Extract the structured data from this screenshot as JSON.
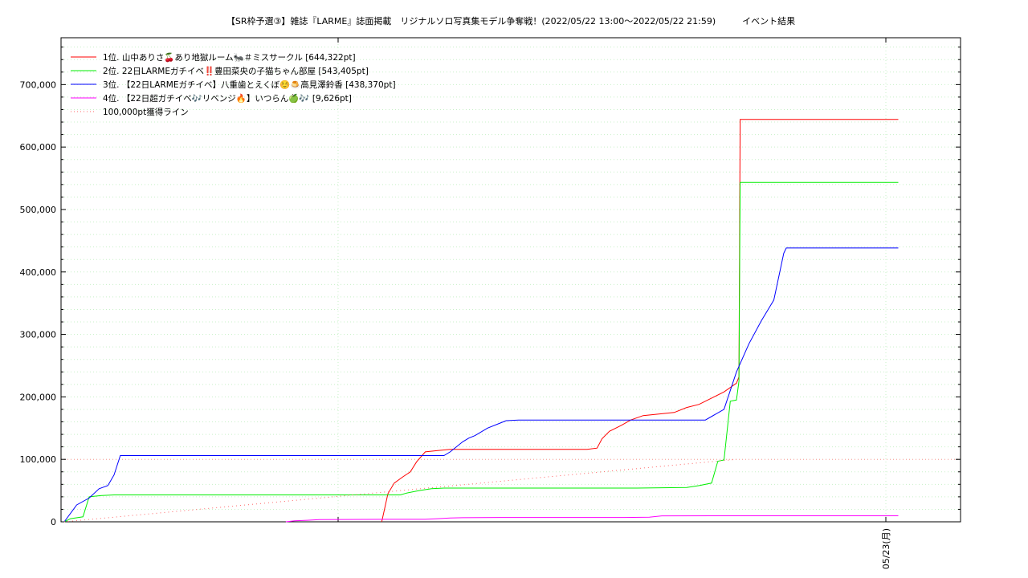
{
  "chart_data": {
    "type": "line",
    "title": "【SR枠予選③】雑誌『LARME』誌面掲載　リジナルソロ写真集モデル争奪戦！(2022/05/22 13:00～2022/05/22 21:59)　　　イベント結果",
    "xlabel": "",
    "ylabel": "",
    "x_unit": "minutes since 2022/05/22 13:00",
    "xlim": [
      0,
      660
    ],
    "ylim": [
      0,
      775000
    ],
    "yticks": [
      0,
      100000,
      200000,
      300000,
      400000,
      500000,
      600000,
      700000
    ],
    "ytick_labels": [
      "0",
      "100,000",
      "200,000",
      "300,000",
      "400,000",
      "500,000",
      "600,000",
      "700,000"
    ],
    "xticks": [
      {
        "x": 660,
        "label": "05/23(月)"
      }
    ],
    "grid": true,
    "legend_position": "top-left",
    "series": [
      {
        "name": "1位. 山中ありさ🍒あり地獄ルーム🐜＃ミスサークル [644,322pt]",
        "color": "#ff0000",
        "style": "solid",
        "points": [
          [
            255,
            0
          ],
          [
            260,
            45000
          ],
          [
            265,
            62000
          ],
          [
            272,
            72000
          ],
          [
            278,
            80000
          ],
          [
            283,
            96000
          ],
          [
            290,
            112000
          ],
          [
            300,
            114000
          ],
          [
            310,
            116000
          ],
          [
            400,
            116000
          ],
          [
            420,
            116000
          ],
          [
            428,
            118000
          ],
          [
            432,
            133000
          ],
          [
            438,
            145000
          ],
          [
            448,
            155000
          ],
          [
            455,
            163000
          ],
          [
            465,
            170000
          ],
          [
            480,
            173000
          ],
          [
            490,
            175000
          ],
          [
            500,
            183000
          ],
          [
            510,
            188000
          ],
          [
            520,
            198000
          ],
          [
            530,
            208000
          ],
          [
            540,
            222000
          ],
          [
            542,
            232000
          ],
          [
            543,
            644322
          ],
          [
            550,
            644322
          ],
          [
            650,
            644322
          ],
          [
            670,
            644322
          ]
        ]
      },
      {
        "name": "2位. 22日LARMEガチイベ‼️豊田菜央の子猫ちゃん部屋 [543,405pt]",
        "color": "#00ee00",
        "style": "solid",
        "points": [
          [
            0,
            0
          ],
          [
            5,
            5000
          ],
          [
            15,
            8000
          ],
          [
            20,
            40000
          ],
          [
            30,
            42000
          ],
          [
            40,
            43000
          ],
          [
            260,
            43000
          ],
          [
            270,
            43000
          ],
          [
            275,
            46000
          ],
          [
            285,
            50000
          ],
          [
            295,
            53000
          ],
          [
            305,
            54000
          ],
          [
            460,
            54000
          ],
          [
            500,
            55000
          ],
          [
            510,
            58000
          ],
          [
            520,
            62000
          ],
          [
            525,
            97000
          ],
          [
            530,
            99000
          ],
          [
            535,
            193000
          ],
          [
            540,
            195000
          ],
          [
            542,
            225000
          ],
          [
            543,
            543405
          ],
          [
            550,
            543405
          ],
          [
            670,
            543405
          ]
        ]
      },
      {
        "name": "3位. 【22日LARMEガチイベ】八重歯とえくぼ☺️🍮高見澤鈴香 [438,370pt]",
        "color": "#0000ff",
        "style": "solid",
        "points": [
          [
            0,
            0
          ],
          [
            10,
            27000
          ],
          [
            20,
            38000
          ],
          [
            28,
            53000
          ],
          [
            35,
            58000
          ],
          [
            40,
            75000
          ],
          [
            45,
            106000
          ],
          [
            50,
            106000
          ],
          [
            305,
            106000
          ],
          [
            310,
            112000
          ],
          [
            315,
            120000
          ],
          [
            320,
            128000
          ],
          [
            325,
            134000
          ],
          [
            330,
            138000
          ],
          [
            340,
            150000
          ],
          [
            350,
            158000
          ],
          [
            355,
            162000
          ],
          [
            365,
            163000
          ],
          [
            400,
            163000
          ],
          [
            500,
            163000
          ],
          [
            515,
            163000
          ],
          [
            530,
            180000
          ],
          [
            540,
            240000
          ],
          [
            550,
            285000
          ],
          [
            560,
            322000
          ],
          [
            570,
            355000
          ],
          [
            578,
            430000
          ],
          [
            580,
            438370
          ],
          [
            590,
            438370
          ],
          [
            670,
            438370
          ]
        ]
      },
      {
        "name": "4位. 【22日超ガチイベ🎶リベンジ🔥】いつらん🍏🎶 [9,626pt]",
        "color": "#ff00ff",
        "style": "solid",
        "points": [
          [
            178,
            0
          ],
          [
            185,
            1500
          ],
          [
            195,
            2500
          ],
          [
            205,
            3500
          ],
          [
            260,
            4000
          ],
          [
            290,
            4000
          ],
          [
            300,
            5000
          ],
          [
            310,
            6000
          ],
          [
            320,
            6500
          ],
          [
            350,
            7000
          ],
          [
            420,
            7000
          ],
          [
            450,
            7000
          ],
          [
            470,
            7500
          ],
          [
            480,
            9500
          ],
          [
            520,
            9626
          ],
          [
            670,
            9626
          ]
        ]
      },
      {
        "name": "100,000pt獲得ライン",
        "color": "#ff6666",
        "style": "dotted",
        "points": [
          [
            0,
            0
          ],
          [
            540,
            100000
          ]
        ]
      }
    ]
  }
}
